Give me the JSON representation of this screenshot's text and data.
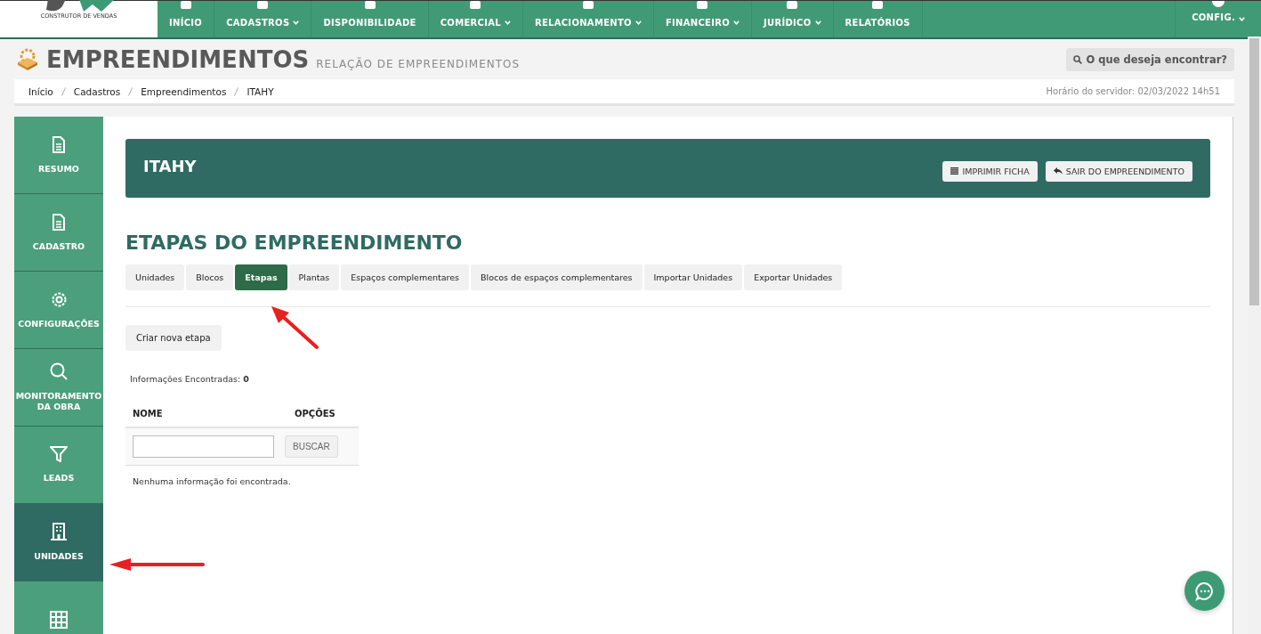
{
  "logo": {
    "tagline": "CONSTRUTOR DE VENDAS"
  },
  "nav": [
    {
      "label": "INÍCIO",
      "dropdown": false
    },
    {
      "label": "CADASTROS",
      "dropdown": true
    },
    {
      "label": "DISPONIBILIDADE",
      "dropdown": false
    },
    {
      "label": "COMERCIAL",
      "dropdown": true
    },
    {
      "label": "RELACIONAMENTO",
      "dropdown": true
    },
    {
      "label": "FINANCEIRO",
      "dropdown": true
    },
    {
      "label": "JURÍDICO",
      "dropdown": true
    },
    {
      "label": "RELATÓRIOS",
      "dropdown": false
    }
  ],
  "config": {
    "label": "CONFIG.",
    "dropdown": true
  },
  "page": {
    "title": "EMPREENDIMENTOS",
    "subtitle": "RELAÇÃO DE EMPREENDIMENTOS",
    "search_button": "O que deseja encontrar?"
  },
  "breadcrumb": [
    "Início",
    "Cadastros",
    "Empreendimentos",
    "ITAHY"
  ],
  "server_time": "Horário do servidor: 02/03/2022 14h51",
  "sidebar": [
    {
      "label": "RESUMO",
      "selected": false
    },
    {
      "label": "CADASTRO",
      "selected": false
    },
    {
      "label": "CONFIGURAÇÕES",
      "selected": false
    },
    {
      "label": "MONITORAMENTO DA OBRA",
      "selected": false
    },
    {
      "label": "LEADS",
      "selected": false
    },
    {
      "label": "UNIDADES",
      "selected": true
    },
    {
      "selected": false
    }
  ],
  "project": {
    "name": "ITAHY",
    "buttons": [
      "IMPRIMIR FICHA",
      "SAIR DO EMPREENDIMENTO"
    ]
  },
  "section_title": "ETAPAS DO EMPREENDIMENTO",
  "tabs": [
    {
      "label": "Unidades",
      "selected": false
    },
    {
      "label": "Blocos",
      "selected": false
    },
    {
      "label": "Etapas",
      "selected": true
    },
    {
      "label": "Plantas",
      "selected": false
    },
    {
      "label": "Espaços complementares",
      "selected": false
    },
    {
      "label": "Blocos de espaços complementares",
      "selected": false
    },
    {
      "label": "Importar Unidades",
      "selected": false
    },
    {
      "label": "Exportar Unidades",
      "selected": false
    }
  ],
  "create_button": "Criar nova etapa",
  "results": {
    "label": "Informações Encontradas:",
    "count": "0"
  },
  "table": {
    "columns": [
      "NOME",
      "OPÇÕES"
    ],
    "search_button": "BUSCAR",
    "empty_message": "Nenhuma informação foi encontrada."
  }
}
